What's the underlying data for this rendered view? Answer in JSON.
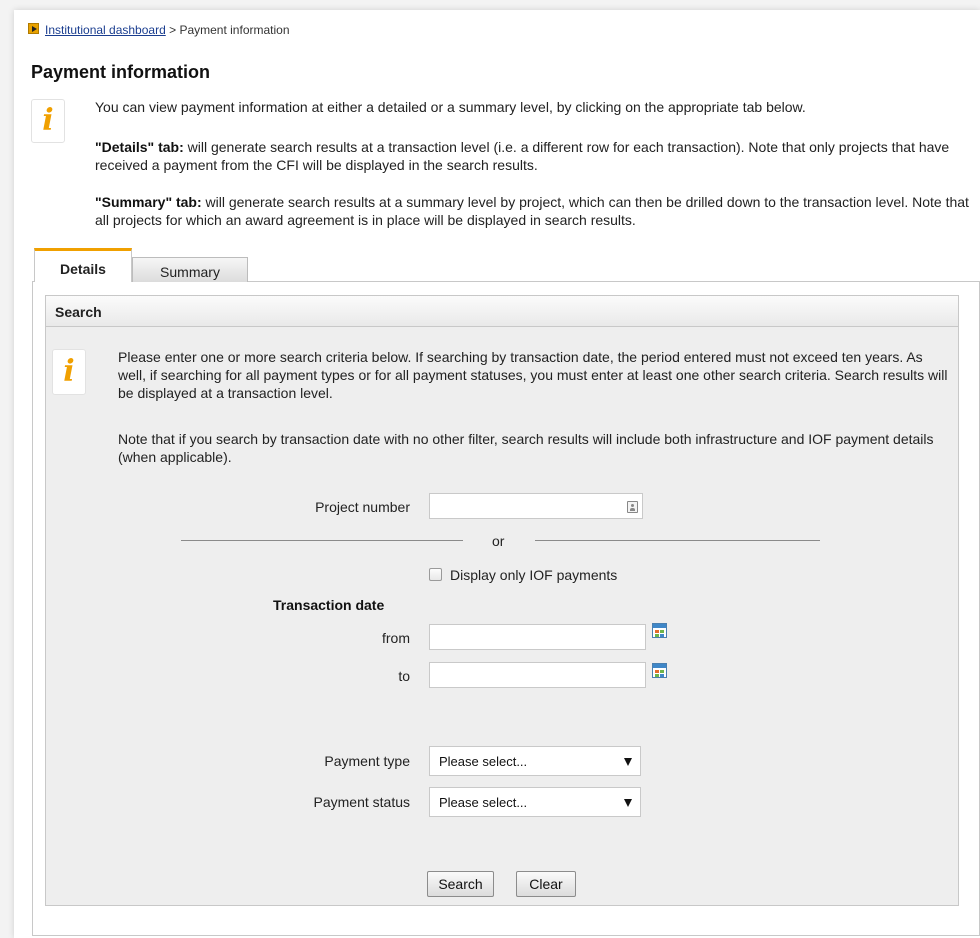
{
  "breadcrumb": {
    "link": "Institutional dashboard",
    "separator": ">",
    "current": "Payment information"
  },
  "page": {
    "title": "Payment information"
  },
  "intro": {
    "line1": "You can view payment information at either a detailed or a summary level, by clicking on the appropriate tab below.",
    "details_label": "\"Details\" tab:",
    "details_text": "will generate search results at a transaction level (i.e. a different row for each transaction). Note that only projects that have received a payment from the CFI will be displayed in the search results.",
    "summary_label": "\"Summary\" tab:",
    "summary_text": "will generate search results at a summary level by project, which can then be drilled down to the transaction level. Note that all projects for which an award agreement is in place will be displayed in search results."
  },
  "tabs": [
    {
      "label": "Details",
      "active": true
    },
    {
      "label": "Summary",
      "active": false
    }
  ],
  "search": {
    "header": "Search",
    "info_p1": "Please enter one or more search criteria below. If searching by transaction date, the period entered must not exceed ten years. As well, if searching for all payment types or for all payment statuses, you must enter at least one other search criteria. Search results will be displayed at a transaction level.",
    "info_p2": "Note that if you search by transaction date with no other filter, search results will include both infrastructure and IOF payment details (when applicable).",
    "project_number_label": "Project number",
    "project_number_value": "",
    "or_text": "or",
    "iof_checkbox_label": "Display only IOF payments",
    "iof_checked": false,
    "transaction_date_label": "Transaction date",
    "from_label": "from",
    "from_value": "",
    "to_label": "to",
    "to_value": "",
    "payment_type_label": "Payment type",
    "payment_type_value": "Please select...",
    "payment_status_label": "Payment status",
    "payment_status_value": "Please select...",
    "search_button": "Search",
    "clear_button": "Clear"
  },
  "colors": {
    "accent": "#f0a000",
    "link": "#1a3d8f",
    "panel_bg": "#eeeeee"
  },
  "icons": {
    "breadcrumb": "arrow-square-icon",
    "info": "info-icon",
    "lookup": "contact-card-icon",
    "calendar": "calendar-icon",
    "dropdown": "chevron-down-icon"
  }
}
